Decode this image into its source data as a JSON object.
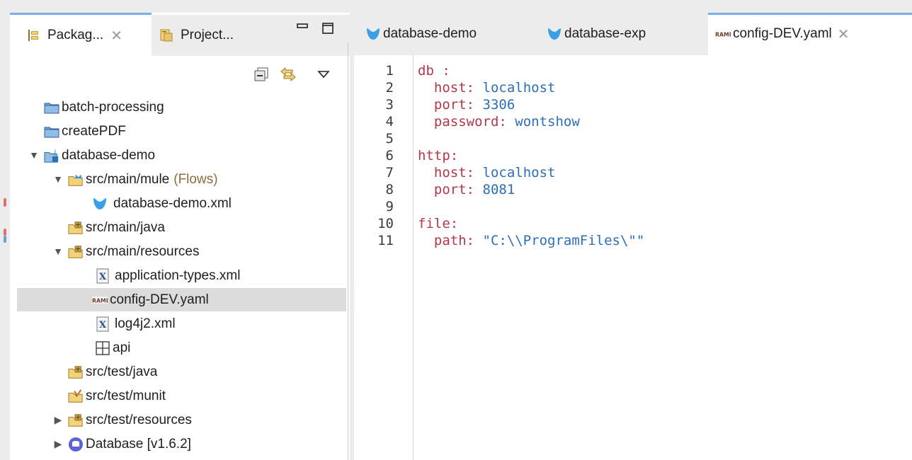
{
  "left_view": {
    "tabs": [
      {
        "label": "Packag...",
        "icon": "package-explorer-icon",
        "active": true
      },
      {
        "label": "Project...",
        "icon": "project-explorer-icon",
        "active": false
      }
    ]
  },
  "tree": [
    {
      "label": "batch-processing",
      "icon": "folder-icon"
    },
    {
      "label": "createPDF",
      "icon": "folder-icon"
    },
    {
      "label": "database-demo",
      "icon": "mule-project-icon",
      "expanded": true
    },
    {
      "label": "src/main/mule",
      "suffix": "(Flows)",
      "icon": "mule-source-folder-icon",
      "expanded": true
    },
    {
      "label": "database-demo.xml",
      "icon": "mule-flow-icon"
    },
    {
      "label": "src/main/java",
      "icon": "source-folder-icon"
    },
    {
      "label": "src/main/resources",
      "icon": "source-folder-icon",
      "expanded": true
    },
    {
      "label": "application-types.xml",
      "icon": "xml-file-icon"
    },
    {
      "label": "config-DEV.yaml",
      "icon": "raml-file-icon",
      "selected": true
    },
    {
      "label": "log4j2.xml",
      "icon": "xml-file-icon"
    },
    {
      "label": "api",
      "icon": "package-icon"
    },
    {
      "label": "src/test/java",
      "icon": "source-folder-icon"
    },
    {
      "label": "src/test/munit",
      "icon": "munit-folder-icon"
    },
    {
      "label": "src/test/resources",
      "icon": "source-folder-icon",
      "expanded": false
    },
    {
      "label": "Database [v1.6.2]",
      "icon": "database-module-icon",
      "expanded": false
    }
  ],
  "editor": {
    "tabs": [
      {
        "label": "database-demo",
        "icon": "mule-flow-icon",
        "active": false
      },
      {
        "label": "database-exp",
        "icon": "mule-flow-icon",
        "active": false
      },
      {
        "label": "config-DEV.yaml",
        "icon": "raml-file-icon",
        "active": true
      }
    ],
    "lines": [
      {
        "n": "1",
        "key": "db :",
        "value": ""
      },
      {
        "n": "2",
        "key": "  host:",
        "value": " localhost"
      },
      {
        "n": "3",
        "key": "  port:",
        "value": " 3306"
      },
      {
        "n": "4",
        "key": "  password:",
        "value": " wontshow"
      },
      {
        "n": "5",
        "key": "",
        "value": ""
      },
      {
        "n": "6",
        "key": "http:",
        "value": ""
      },
      {
        "n": "7",
        "key": "  host:",
        "value": " localhost"
      },
      {
        "n": "8",
        "key": "  port:",
        "value": " 8081"
      },
      {
        "n": "9",
        "key": "",
        "value": ""
      },
      {
        "n": "10",
        "key": "file:",
        "value": ""
      },
      {
        "n": "11",
        "key": "  path:",
        "value": " \"C:\\\\ProgramFiles\\\"\""
      }
    ]
  },
  "colors": {
    "accent": "#7bb1e8",
    "yaml_key": "#b3364b",
    "yaml_value": "#2b6fb8",
    "selection": "#dcdcdc"
  }
}
